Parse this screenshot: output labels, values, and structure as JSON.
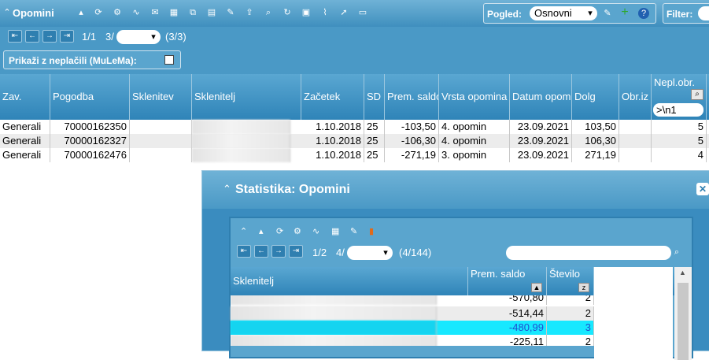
{
  "header": {
    "title": "Opomini",
    "pogled_label": "Pogled:",
    "pogled_value": "Osnovni",
    "filter_label": "Filter:"
  },
  "nav": {
    "page": "1/1",
    "page_of": "3/",
    "count": "(3/3)"
  },
  "filter": {
    "unpaid_label": "Prikaži z neplačili (MuLeMa):"
  },
  "table": {
    "columns": [
      "Zav.",
      "Pogodba",
      "Sklenitev",
      "Sklenitelj",
      "Začetek",
      "SD",
      "Prem. saldo",
      "Vrsta opomina",
      "Datum opom",
      "Dolg",
      "Obr.iz",
      "Nepl.obr."
    ],
    "nepl_filter_value": ">\\n1",
    "rows": [
      {
        "zav": "Generali",
        "pogodba": "70000162350",
        "zacetek": "1.10.2018",
        "sd": "25",
        "saldo": "-103,50",
        "vrsta": "4. opomin",
        "datum": "23.09.2021",
        "dolg": "103,50",
        "nepl": "5"
      },
      {
        "zav": "Generali",
        "pogodba": "70000162327",
        "zacetek": "1.10.2018",
        "sd": "25",
        "saldo": "-106,30",
        "vrsta": "4. opomin",
        "datum": "23.09.2021",
        "dolg": "106,30",
        "nepl": "5"
      },
      {
        "zav": "Generali",
        "pogodba": "70000162476",
        "zacetek": "1.10.2018",
        "sd": "25",
        "saldo": "-271,19",
        "vrsta": "3. opomin",
        "datum": "23.09.2021",
        "dolg": "271,19",
        "nepl": "4"
      }
    ]
  },
  "stats": {
    "title": "Statistika: Opomini",
    "page": "1/2",
    "page_of": "4/",
    "count": "(4/144)",
    "columns": [
      "Sklenitelj",
      "Prem. saldo",
      "Število"
    ],
    "rows": [
      {
        "saldo": "-570,80",
        "stevilo": "2"
      },
      {
        "saldo": "-514,44",
        "stevilo": "2"
      },
      {
        "saldo": "-480,99",
        "stevilo": "3"
      },
      {
        "saldo": "-225,11",
        "stevilo": "2"
      }
    ]
  }
}
